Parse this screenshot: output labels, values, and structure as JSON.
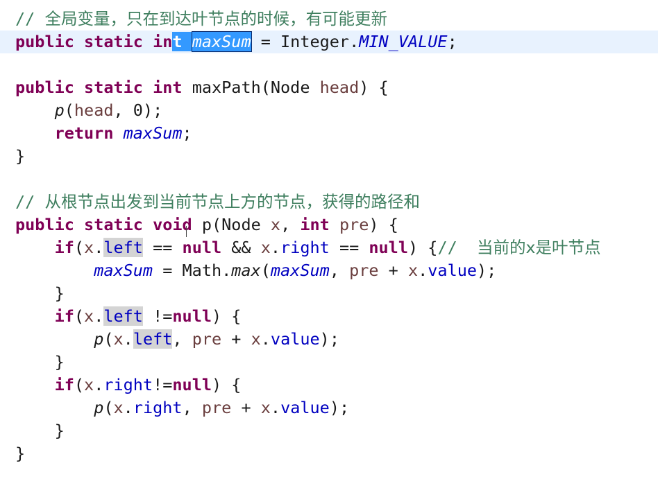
{
  "comments": {
    "global_var": "//",
    "global_var_cn": "全局变量，只在到达叶节点的时候，有可能更新",
    "p_method": "//",
    "p_method_cn": "从根节点出发到当前节点上方的节点，获得的路径和",
    "leaf": "//",
    "leaf_cn": "当前的x是叶节点"
  },
  "tokens": {
    "public": "public",
    "static": "static",
    "int_prefix": "in",
    "int_suffix": "t",
    "int": "int",
    "void_prefix": "voi",
    "void_suffix": "d",
    "if": "if",
    "null": "null",
    "return": "return",
    "maxSum": "maxSum",
    "eq_integer": " = Integer.",
    "MIN_VALUE": "MIN_VALUE",
    "semicolon": ";",
    "maxPath": "maxPath(Node ",
    "head": "head",
    "close_paren_brace": ") {",
    "p": "p",
    "open_paren": "(",
    "zero_close": ", 0);",
    "close_brace": "}",
    "p_sig": "p(Node ",
    "x": "x",
    "comma_space": ", ",
    "pre": "pre",
    "x_dot": "x.",
    "left": "left",
    "right": "right",
    "value": "value",
    "eqeq": " == ",
    "and": " && ",
    "ne_null_left": " !=",
    "ne_null_right": "!=",
    "paren_brace_nospace": ") {",
    "assign": " = Math.",
    "max": "max",
    "plus": " + ",
    "close_semicolon": ");"
  }
}
